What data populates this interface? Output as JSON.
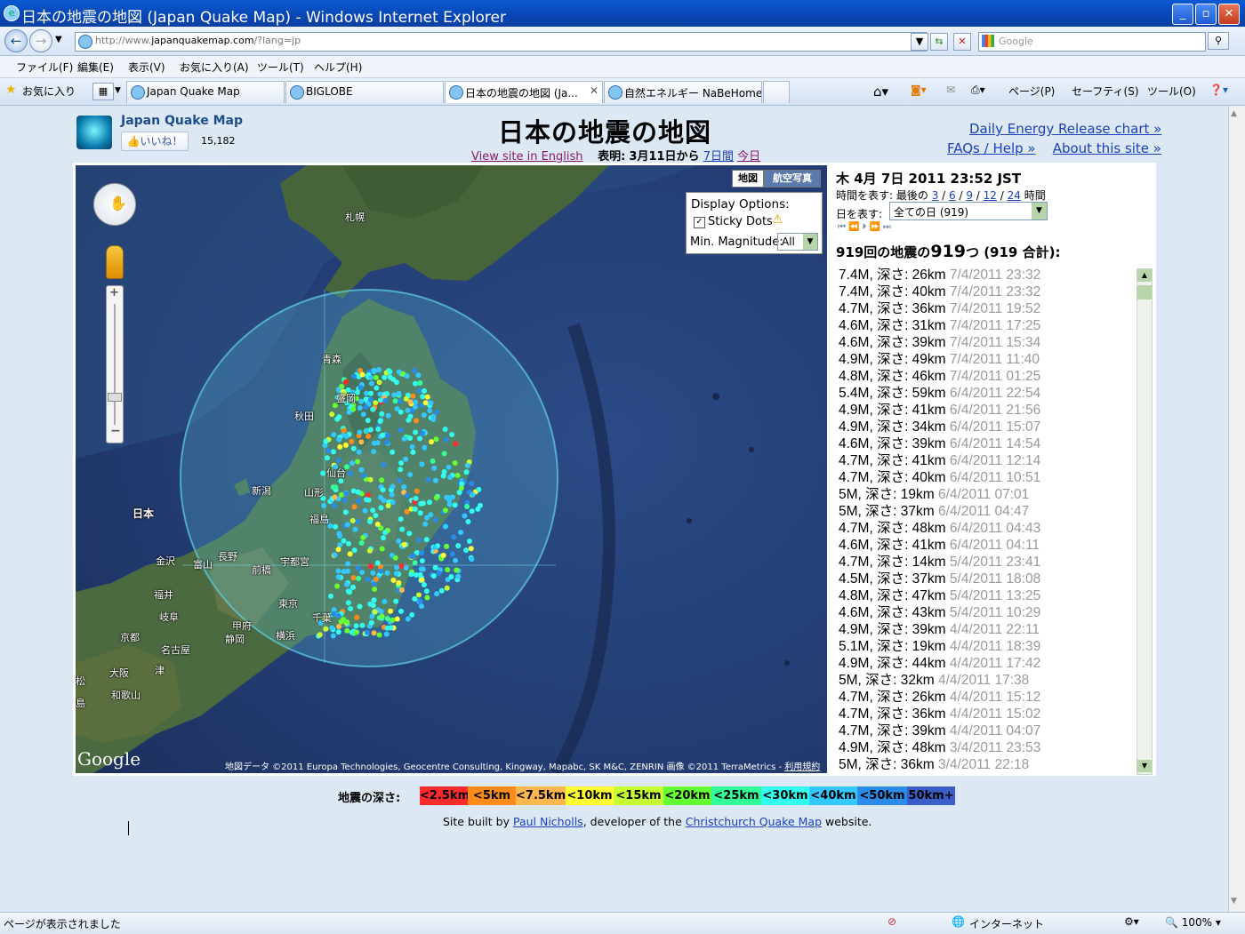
{
  "window": {
    "title": "日本の地震の地図 (Japan Quake Map) - Windows Internet Explorer",
    "controls": [
      "minimize",
      "maximize",
      "close"
    ]
  },
  "addressbar": {
    "url_prefix": "http://www.",
    "url_domain": "japanquakemap.com",
    "url_rest": "/?lang=jp",
    "search_placeholder": "Google"
  },
  "menu": [
    "ファイル(F)",
    "編集(E)",
    "表示(V)",
    "お気に入り(A)",
    "ツール(T)",
    "ヘルプ(H)"
  ],
  "tabs": {
    "favorites_label": "お気に入り",
    "items": [
      {
        "label": "Japan Quake Map",
        "active": false
      },
      {
        "label": "BIGLOBE",
        "active": false
      },
      {
        "label": "日本の地震の地図 (Ja...",
        "active": true
      },
      {
        "label": "自然エネルギー NaBeHome",
        "active": false
      }
    ],
    "toolbar": [
      "ページ(P)",
      "セーフティ(S)",
      "ツール(O)"
    ]
  },
  "header": {
    "site_name": "Japan Quake Map",
    "like_label": "いいね！",
    "like_count": "15,182",
    "page_title": "日本の地震の地図",
    "view_english": "View site in English",
    "show_label": "表明:",
    "since_label": "3月11日から",
    "week_link": "7日間",
    "today_link": "今日",
    "energy_link": "Daily Energy Release chart »",
    "faq_link": "FAQs / Help »",
    "about_link": "About this site »"
  },
  "map": {
    "type_buttons": [
      "地図",
      "航空写真"
    ],
    "display_options_title": "Display Options:",
    "sticky_dots_label": "Sticky Dots",
    "min_mag_label": "Min. Magnitude:",
    "min_mag_value": "All",
    "cities": [
      "札幌",
      "青森",
      "盛岡",
      "秋田",
      "仙台",
      "山形",
      "新潟",
      "福島",
      "日本",
      "金沢",
      "富山",
      "長野",
      "前橋",
      "宇都宮",
      "福井",
      "岐阜",
      "甲府",
      "東京",
      "千葉",
      "京都",
      "名古屋",
      "静岡",
      "横浜",
      "大阪",
      "津",
      "和歌山",
      "松",
      "島"
    ],
    "attribution": "地図データ ©2011 Europa Technologies, Geocentre Consulting, Kingway, Mapabc, SK M&C, ZENRIN 画像 ©2011 TerraMetrics - ",
    "terms_link": "利用規約",
    "google_logo": "Google"
  },
  "sidebar": {
    "datetime": "木 4月 7日 2011 23:52 JST",
    "hours_label": "時間を表す: 最後の",
    "hours_options": [
      "3",
      "6",
      "9",
      "12",
      "24"
    ],
    "hours_suffix": "時間",
    "days_label": "日を表す:",
    "days_value": "全ての日 (919)",
    "count_prefix": "919回の地震の",
    "count_big": "919",
    "count_suffix": "つ (919 合計):",
    "quakes": [
      {
        "mag": "7.4M",
        "depth": "26km",
        "date": "7/4/2011 23:32"
      },
      {
        "mag": "7.4M",
        "depth": "40km",
        "date": "7/4/2011 23:32"
      },
      {
        "mag": "4.7M",
        "depth": "36km",
        "date": "7/4/2011 19:52"
      },
      {
        "mag": "4.6M",
        "depth": "31km",
        "date": "7/4/2011 17:25"
      },
      {
        "mag": "4.6M",
        "depth": "39km",
        "date": "7/4/2011 15:34"
      },
      {
        "mag": "4.9M",
        "depth": "49km",
        "date": "7/4/2011 11:40"
      },
      {
        "mag": "4.8M",
        "depth": "46km",
        "date": "7/4/2011 01:25"
      },
      {
        "mag": "5.4M",
        "depth": "59km",
        "date": "6/4/2011 22:54"
      },
      {
        "mag": "4.9M",
        "depth": "41km",
        "date": "6/4/2011 21:56"
      },
      {
        "mag": "4.9M",
        "depth": "34km",
        "date": "6/4/2011 15:07"
      },
      {
        "mag": "4.6M",
        "depth": "39km",
        "date": "6/4/2011 14:54"
      },
      {
        "mag": "4.7M",
        "depth": "41km",
        "date": "6/4/2011 12:14"
      },
      {
        "mag": "4.7M",
        "depth": "40km",
        "date": "6/4/2011 10:51"
      },
      {
        "mag": "5M",
        "depth": "19km",
        "date": "6/4/2011 07:01"
      },
      {
        "mag": "5M",
        "depth": "37km",
        "date": "6/4/2011 04:47"
      },
      {
        "mag": "4.7M",
        "depth": "48km",
        "date": "6/4/2011 04:43"
      },
      {
        "mag": "4.6M",
        "depth": "41km",
        "date": "6/4/2011 04:11"
      },
      {
        "mag": "4.7M",
        "depth": "14km",
        "date": "5/4/2011 23:41"
      },
      {
        "mag": "4.5M",
        "depth": "37km",
        "date": "5/4/2011 18:08"
      },
      {
        "mag": "4.8M",
        "depth": "47km",
        "date": "5/4/2011 13:25"
      },
      {
        "mag": "4.6M",
        "depth": "43km",
        "date": "5/4/2011 10:29"
      },
      {
        "mag": "4.9M",
        "depth": "39km",
        "date": "4/4/2011 22:11"
      },
      {
        "mag": "5.1M",
        "depth": "19km",
        "date": "4/4/2011 18:39"
      },
      {
        "mag": "4.9M",
        "depth": "44km",
        "date": "4/4/2011 17:42"
      },
      {
        "mag": "5M",
        "depth": "32km",
        "date": "4/4/2011 17:38"
      },
      {
        "mag": "4.7M",
        "depth": "26km",
        "date": "4/4/2011 15:12"
      },
      {
        "mag": "4.7M",
        "depth": "36km",
        "date": "4/4/2011 15:02"
      },
      {
        "mag": "4.7M",
        "depth": "39km",
        "date": "4/4/2011 04:07"
      },
      {
        "mag": "4.9M",
        "depth": "48km",
        "date": "3/4/2011 23:53"
      },
      {
        "mag": "5M",
        "depth": "36km",
        "date": "3/4/2011 22:18"
      }
    ],
    "depth_word": "深さ:"
  },
  "legend": {
    "label": "地震の深さ:",
    "items": [
      {
        "text": "<2.5km",
        "color": "#ff2a2a"
      },
      {
        "text": "<5km",
        "color": "#ff8c1a"
      },
      {
        "text": "<7.5km",
        "color": "#ffb84d"
      },
      {
        "text": "<10km",
        "color": "#ffff33"
      },
      {
        "text": "<15km",
        "color": "#c8ff33"
      },
      {
        "text": "<20km",
        "color": "#66ff33"
      },
      {
        "text": "<25km",
        "color": "#33ff99"
      },
      {
        "text": "<30km",
        "color": "#33ffee"
      },
      {
        "text": "<40km",
        "color": "#33c8ff"
      },
      {
        "text": "<50km",
        "color": "#2a8ce8"
      },
      {
        "text": "50km+",
        "color": "#3a5fc8"
      }
    ]
  },
  "credit": {
    "pre": "Site built by ",
    "author": "Paul Nicholls",
    "mid": ", developer of the ",
    "link": "Christchurch Quake Map",
    "post": " website."
  },
  "statusbar": {
    "text": "ページが表示されました",
    "zone": "インターネット",
    "zoom": "100%"
  },
  "colors": {
    "titlebar": "#0a5ad3",
    "link": "#1a3fbf",
    "page_bg": "#dce9f5"
  }
}
